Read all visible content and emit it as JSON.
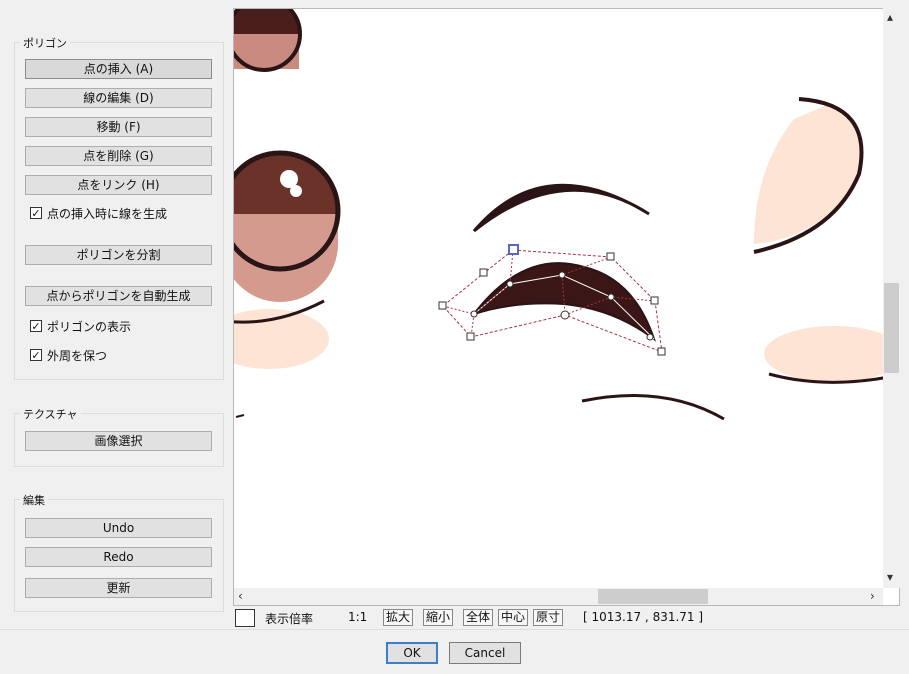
{
  "polygon_group": {
    "title": "ポリゴン",
    "buttons": [
      "点の挿入 (A)",
      "線の編集 (D)",
      "移動 (F)",
      "点を削除 (G)",
      "点をリンク (H)"
    ],
    "check_insert_label": "点の挿入時に線を生成",
    "split_button": "ポリゴンを分割",
    "generate_button": "点からポリゴンを自動生成",
    "check_show_polygon_label": "ポリゴンの表示",
    "check_outline_label": "外周を保つ"
  },
  "texture_group": {
    "title": "テクスチャ",
    "select_image_button": "画像選択"
  },
  "edit_group": {
    "title": "編集",
    "undo_button": "Undo",
    "redo_button": "Redo",
    "update_button": "更新"
  },
  "status": {
    "display_label": "表示倍率",
    "zoom_value": "1:1",
    "zoom_in": "拡大",
    "zoom_out": "縮小",
    "fit_all": "全体",
    "center": "中心",
    "actual_size": "原寸",
    "coords": "[ 1013.17 , 831.71 ]"
  },
  "dialog": {
    "ok_label": "OK",
    "cancel_label": "Cancel"
  },
  "colors": {
    "accent": "#3c7fc7",
    "stroke": "#2a1416",
    "skin": "#fde4d4",
    "selected_vertex": "#5566cc",
    "guide_line": "#b03040"
  },
  "icons": {
    "scroll_up": "▲-icon",
    "scroll_down": "▼-icon",
    "scroll_left": "◀-icon",
    "scroll_right": "▶-icon"
  }
}
